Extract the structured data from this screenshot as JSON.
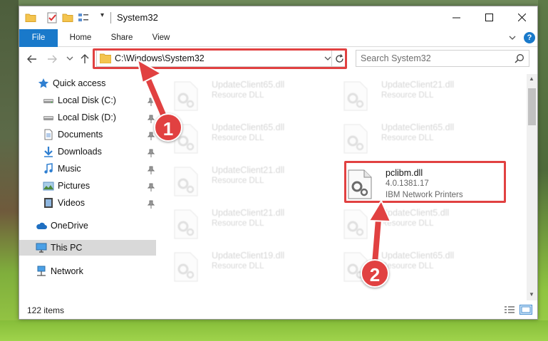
{
  "window": {
    "title": "System32",
    "controls": {
      "minimize": "minimize",
      "maximize": "maximize",
      "close": "close"
    }
  },
  "ribbon": {
    "tabs": [
      {
        "label": "File"
      },
      {
        "label": "Home"
      },
      {
        "label": "Share"
      },
      {
        "label": "View"
      }
    ],
    "help": "?"
  },
  "navbar": {
    "address": "C:\\Windows\\System32",
    "search_placeholder": "Search System32"
  },
  "sidebar": {
    "items": [
      {
        "label": "Quick access",
        "icon": "star-icon"
      },
      {
        "label": "Local Disk (C:)",
        "icon": "drive-icon",
        "pinned": true
      },
      {
        "label": "Local Disk (D:)",
        "icon": "drive-icon",
        "pinned": true
      },
      {
        "label": "Documents",
        "icon": "documents-icon",
        "pinned": true
      },
      {
        "label": "Downloads",
        "icon": "downloads-icon",
        "pinned": true
      },
      {
        "label": "Music",
        "icon": "music-icon",
        "pinned": true
      },
      {
        "label": "Pictures",
        "icon": "pictures-icon",
        "pinned": true
      },
      {
        "label": "Videos",
        "icon": "videos-icon",
        "pinned": true
      },
      {
        "label": "OneDrive",
        "icon": "cloud-icon"
      },
      {
        "label": "This PC",
        "icon": "computer-icon",
        "selected": true
      },
      {
        "label": "Network",
        "icon": "network-icon"
      }
    ]
  },
  "files": [
    {
      "name": "UpdateClient65.dll",
      "meta": "Resource DLL"
    },
    {
      "name": "UpdateClient21.dll",
      "meta": "Resource DLL"
    },
    {
      "name": "UpdateClient65.dll",
      "meta": "Resource DLL"
    },
    {
      "name": "UpdateClient65.dll",
      "meta": "Resource DLL"
    },
    {
      "name": "UpdateClient21.dll",
      "meta": "Resource DLL"
    },
    {
      "name": "pclibm.dll",
      "meta": "4.0.1381.17",
      "meta2": "IBM Network Printers"
    },
    {
      "name": "UpdateClient21.dll",
      "meta": "Resource DLL"
    },
    {
      "name": "UpdateClient5.dll",
      "meta": "Resource DLL"
    },
    {
      "name": "UpdateClient19.dll",
      "meta": "Resource DLL"
    },
    {
      "name": "UpdateClient65.dll",
      "meta": "Resource DLL"
    }
  ],
  "status": {
    "item_count": "122 items"
  },
  "annotations": {
    "step1": "1",
    "step2": "2",
    "color": "#e14141"
  },
  "colors": {
    "accent": "#1979ca",
    "selection": "#d9d9d9"
  }
}
